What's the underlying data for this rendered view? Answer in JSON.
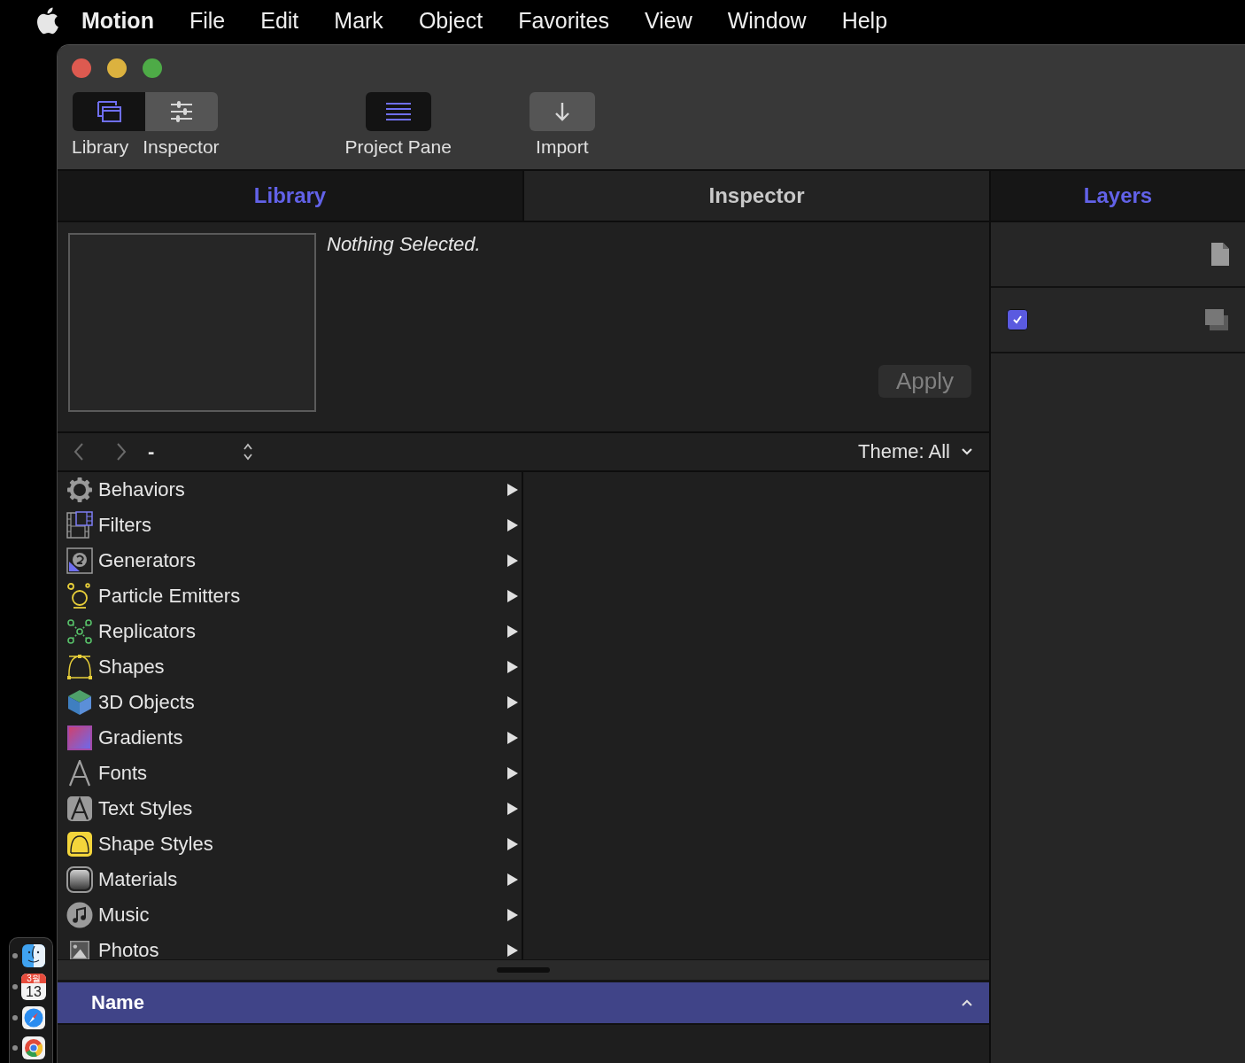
{
  "menu_bar": {
    "app_name": "Motion",
    "items": [
      "File",
      "Edit",
      "Mark",
      "Object",
      "Favorites",
      "View",
      "Window",
      "Help"
    ]
  },
  "dock": {
    "items": [
      {
        "running": true
      },
      {
        "running": true,
        "month": "3월",
        "day": "13"
      },
      {
        "running": true
      },
      {
        "running": true
      }
    ]
  },
  "toolbar": {
    "items": [
      {
        "label": "Library",
        "on": true
      },
      {
        "label": "Inspector",
        "on": false
      },
      {
        "label": "Project Pane",
        "on": true
      },
      {
        "label": "Import",
        "on": false
      }
    ]
  },
  "tabs": [
    {
      "label": "Library",
      "selected": true
    },
    {
      "label": "Inspector",
      "selected": false
    }
  ],
  "preview": {
    "message": "Nothing Selected.",
    "apply_button": {
      "label": "Apply",
      "disabled": true
    }
  },
  "browser_nav": {
    "back_disabled": true,
    "forward_disabled": true,
    "path": "-",
    "theme_filter": "Theme: All"
  },
  "categories": [
    {
      "label": "Behaviors"
    },
    {
      "label": "Filters"
    },
    {
      "label": "Generators"
    },
    {
      "label": "Particle Emitters"
    },
    {
      "label": "Replicators"
    },
    {
      "label": "Shapes"
    },
    {
      "label": "3D Objects"
    },
    {
      "label": "Gradients"
    },
    {
      "label": "Fonts"
    },
    {
      "label": "Text Styles"
    },
    {
      "label": "Shape Styles"
    },
    {
      "label": "Materials"
    },
    {
      "label": "Music"
    },
    {
      "label": "Photos"
    }
  ],
  "file_list": {
    "columns": [
      {
        "label": "Name",
        "ascending": true
      }
    ]
  },
  "layers_panel": {
    "tab": {
      "label": "Layers",
      "selected": true
    },
    "rows": [
      {
        "kind": "project"
      },
      {
        "kind": "group",
        "checked": true
      }
    ]
  }
}
